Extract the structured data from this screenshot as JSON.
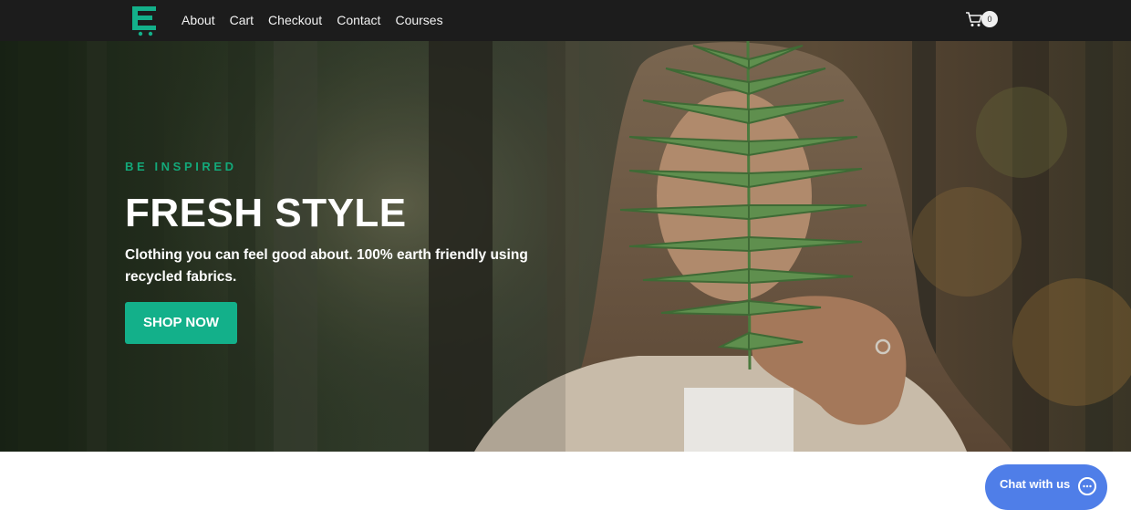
{
  "nav": {
    "logo_icon": "cart-e-logo-icon",
    "links": [
      "About",
      "Cart",
      "Checkout",
      "Contact",
      "Courses"
    ],
    "cart_icon": "shopping-cart-icon",
    "cart_count": "0"
  },
  "hero": {
    "eyebrow": "BE INSPIRED",
    "headline": "FRESH STYLE",
    "subtext": "Clothing you can feel good about. 100% earth friendly using recycled fabrics.",
    "button_label": "SHOP NOW",
    "image": "woman holding a fern leaf in a forest"
  },
  "chat": {
    "label": "Chat with us",
    "icon": "chat-bubble-icon",
    "color": "#4f7ee8"
  },
  "colors": {
    "nav_bg": "#1c1c1c",
    "accent": "#13b08a",
    "eyebrow": "#13a97a",
    "chat": "#4f7ee8"
  }
}
